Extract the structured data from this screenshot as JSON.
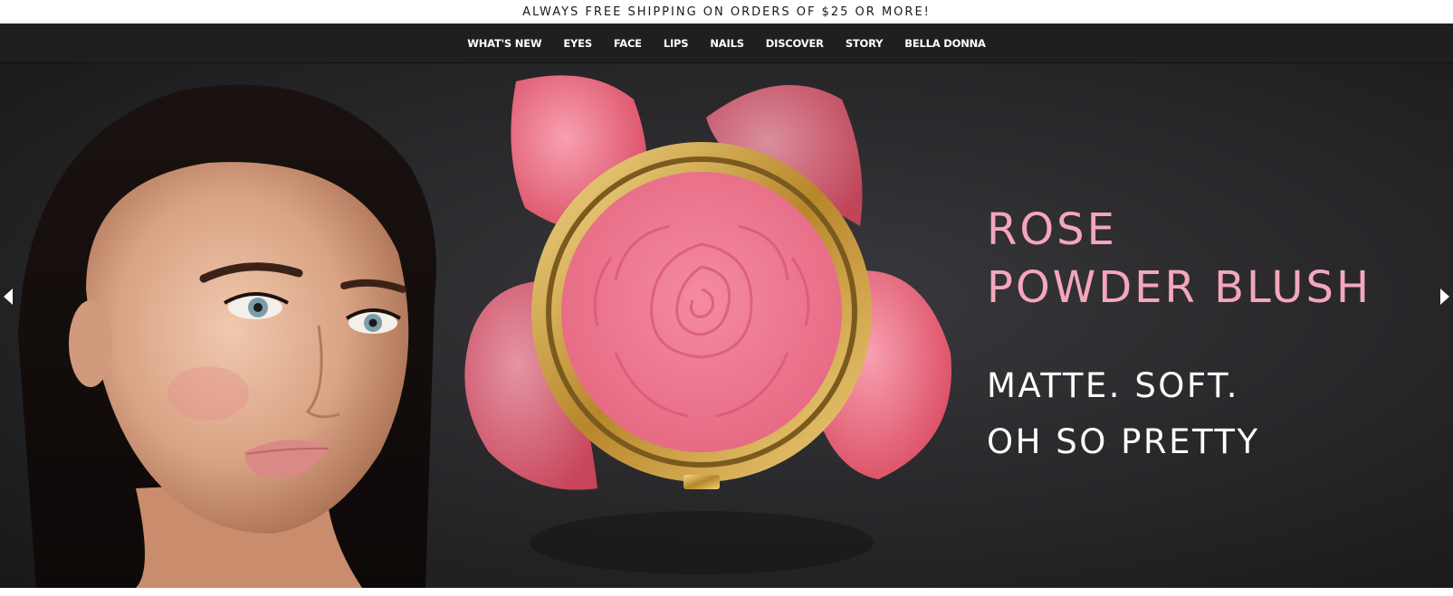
{
  "promo": {
    "text": "ALWAYS FREE SHIPPING ON ORDERS OF $25 OR MORE!"
  },
  "nav": {
    "items": [
      {
        "label": "WHAT'S NEW"
      },
      {
        "label": "EYES"
      },
      {
        "label": "FACE"
      },
      {
        "label": "LIPS"
      },
      {
        "label": "NAILS"
      },
      {
        "label": "DISCOVER"
      },
      {
        "label": "STORY"
      },
      {
        "label": "BELLA DONNA"
      }
    ]
  },
  "hero": {
    "headline_line1": "ROSE",
    "headline_line2": "POWDER BLUSH",
    "tagline_line1": "MATTE. SOFT.",
    "tagline_line2": "OH SO PRETTY",
    "icons": {
      "prev": "chevron-left-icon",
      "next": "chevron-right-icon"
    }
  },
  "colors": {
    "headline": "#f4a7bc",
    "nav_bg": "#1f1f20",
    "hero_bg": "#2a292c",
    "blush": "#ef7b93",
    "gold": "#c9a24a"
  }
}
